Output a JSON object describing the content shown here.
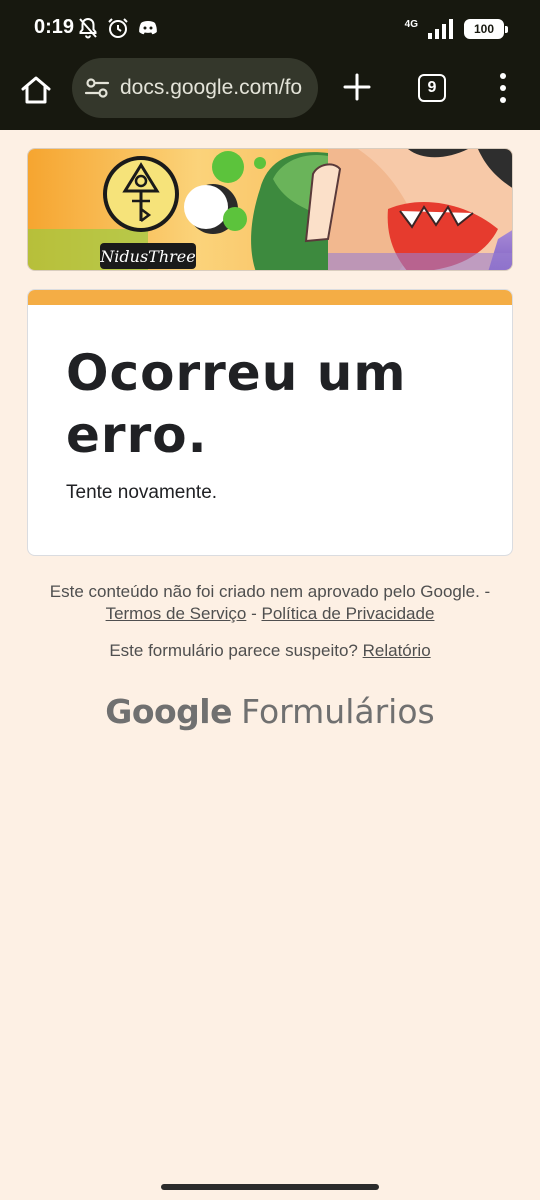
{
  "status_bar": {
    "time": "0:19",
    "network": "4G",
    "battery": "100"
  },
  "browser": {
    "url": "docs.google.com/fo",
    "tab_count": "9"
  },
  "banner": {
    "logo_text": "NidusThree"
  },
  "card": {
    "title": "Ocorreu um erro.",
    "subtitle": "Tente novamente.",
    "accent_color": "#f4ad45"
  },
  "footer": {
    "disclaimer_text": "Este conteúdo não foi criado nem aprovado pelo Google. -",
    "terms_label": "Termos de Serviço",
    "separator": "-",
    "privacy_label": "Política de Privacidade",
    "report_prompt": "Este formulário parece suspeito?",
    "report_label": "Relatório",
    "brand_google": "Google",
    "brand_forms": "Formulários"
  },
  "icons": [
    "home-icon",
    "site-settings-icon",
    "plus-icon",
    "tabs-icon",
    "more-vert-icon",
    "notifications-off-icon",
    "alarm-icon",
    "discord-icon"
  ]
}
